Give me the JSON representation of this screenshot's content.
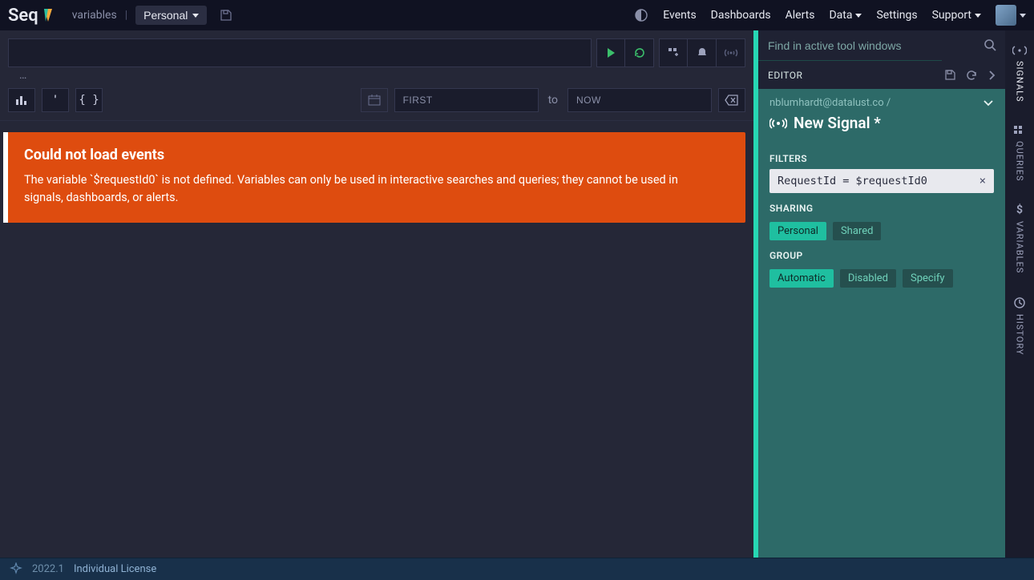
{
  "app": {
    "name": "Seq"
  },
  "breadcrumb": {
    "item": "variables"
  },
  "workspace": {
    "label": "Personal"
  },
  "nav": {
    "events": "Events",
    "dashboards": "Dashboards",
    "alerts": "Alerts",
    "data": "Data",
    "settings": "Settings",
    "support": "Support"
  },
  "query": {
    "ellipsis": "…"
  },
  "range": {
    "from": "FIRST",
    "to_label": "to",
    "to": "NOW"
  },
  "error": {
    "title": "Could not load events",
    "body": "The variable `$requestId0` is not defined. Variables can only be used in interactive searches and queries; they cannot be used in signals, dashboards, or alerts."
  },
  "finder": {
    "placeholder": "Find in active tool windows"
  },
  "editor": {
    "heading": "EDITOR",
    "owner": "nblumhardt@datalust.co /",
    "signal_name": "New Signal *",
    "filters_label": "FILTERS",
    "filter_expr": "RequestId = $requestId0",
    "sharing_label": "SHARING",
    "sharing": {
      "personal": "Personal",
      "shared": "Shared"
    },
    "group_label": "GROUP",
    "group": {
      "automatic": "Automatic",
      "disabled": "Disabled",
      "specify": "Specify"
    }
  },
  "sidestrip": {
    "signals": "SIGNALS",
    "queries": "QUERIES",
    "variables": "VARIABLES",
    "history": "HISTORY"
  },
  "footer": {
    "version": "2022.1",
    "license": "Individual License"
  }
}
